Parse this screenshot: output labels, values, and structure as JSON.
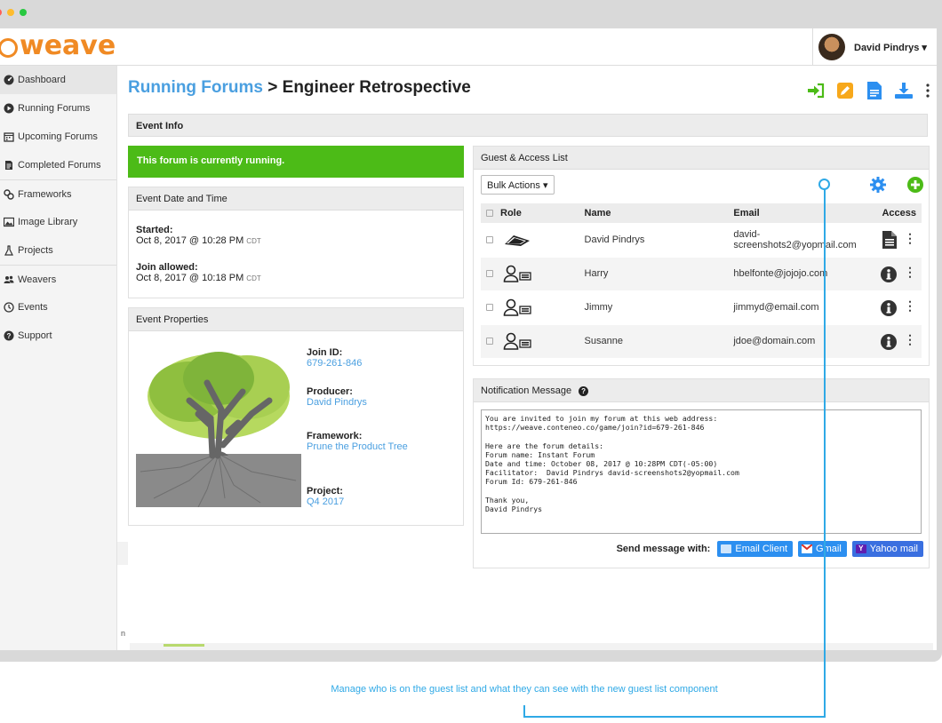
{
  "app": {
    "logo": "weave",
    "user_name": "David Pindrys ▾"
  },
  "sidebar": {
    "items": [
      {
        "label": "Dashboard",
        "icon": "dashboard-icon"
      },
      {
        "label": "Running Forums",
        "icon": "play-icon"
      },
      {
        "label": "Upcoming Forums",
        "icon": "calendar-icon"
      },
      {
        "label": "Completed Forums",
        "icon": "document-icon"
      },
      {
        "label": "Frameworks",
        "icon": "frameworks-icon"
      },
      {
        "label": "Image Library",
        "icon": "image-icon"
      },
      {
        "label": "Projects",
        "icon": "flask-icon"
      },
      {
        "label": "Weavers",
        "icon": "people-icon"
      },
      {
        "label": "Events",
        "icon": "clock-icon"
      },
      {
        "label": "Support",
        "icon": "help-icon"
      }
    ]
  },
  "header": {
    "crumb": "Running Forums",
    "sep": " > ",
    "current": "Engineer Retrospective"
  },
  "event_info": {
    "title": "Event Info",
    "status": "This forum is currently running."
  },
  "date_time": {
    "title": "Event Date and Time",
    "started_label": "Started:",
    "started_value": "Oct 8, 2017 @ 10:28 PM",
    "started_tz": "CDT",
    "join_label": "Join allowed:",
    "join_value": "Oct 8, 2017 @ 10:18 PM",
    "join_tz": "CDT"
  },
  "properties": {
    "title": "Event Properties",
    "join_id_label": "Join ID:",
    "join_id": "679-261-846",
    "producer_label": "Producer:",
    "producer": "David Pindrys",
    "framework_label": "Framework:",
    "framework": "Prune the Product Tree",
    "project_label": "Project:",
    "project": "Q4 2017"
  },
  "guests": {
    "title": "Guest & Access List",
    "bulk_label": "Bulk Actions ▾",
    "headers": {
      "role": "Role",
      "name": "Name",
      "email": "Email",
      "access": "Access"
    },
    "rows": [
      {
        "role": "facilitator",
        "name": "David Pindrys",
        "email": "david-screenshots2@yopmail.com",
        "access": "document"
      },
      {
        "role": "guest",
        "name": "Harry",
        "email": "hbelfonte@jojojo.com",
        "access": "info"
      },
      {
        "role": "guest",
        "name": "Jimmy",
        "email": "jimmyd@email.com",
        "access": "info"
      },
      {
        "role": "guest",
        "name": "Susanne",
        "email": "jdoe@domain.com",
        "access": "info"
      }
    ]
  },
  "notification": {
    "title": "Notification Message",
    "message": "You are invited to join my forum at this web address:\nhttps://weave.conteneo.co/game/join?id=679-261-846\n\nHere are the forum details:\nForum name: Instant Forum\nDate and time: October 08, 2017 @ 10:28PM CDT(-05:00)\nFacilitator:  David Pindrys david-screenshots2@yopmail.com\nForum Id: 679-261-846\n\nThank you,\nDavid Pindrys",
    "send_label": "Send message with:",
    "email_client": "Email Client",
    "gmail": "Gmail",
    "yahoo": "Yahoo mail"
  },
  "misc": {
    "stray": "n"
  },
  "callout": {
    "caption": "Manage who is on the guest list and what they can see with the new guest list component",
    "color": "#2fa9e6"
  },
  "colors": {
    "accent_blue": "#4a9fe0",
    "running_green": "#4cbb17",
    "logo_orange": "#f08a24"
  }
}
